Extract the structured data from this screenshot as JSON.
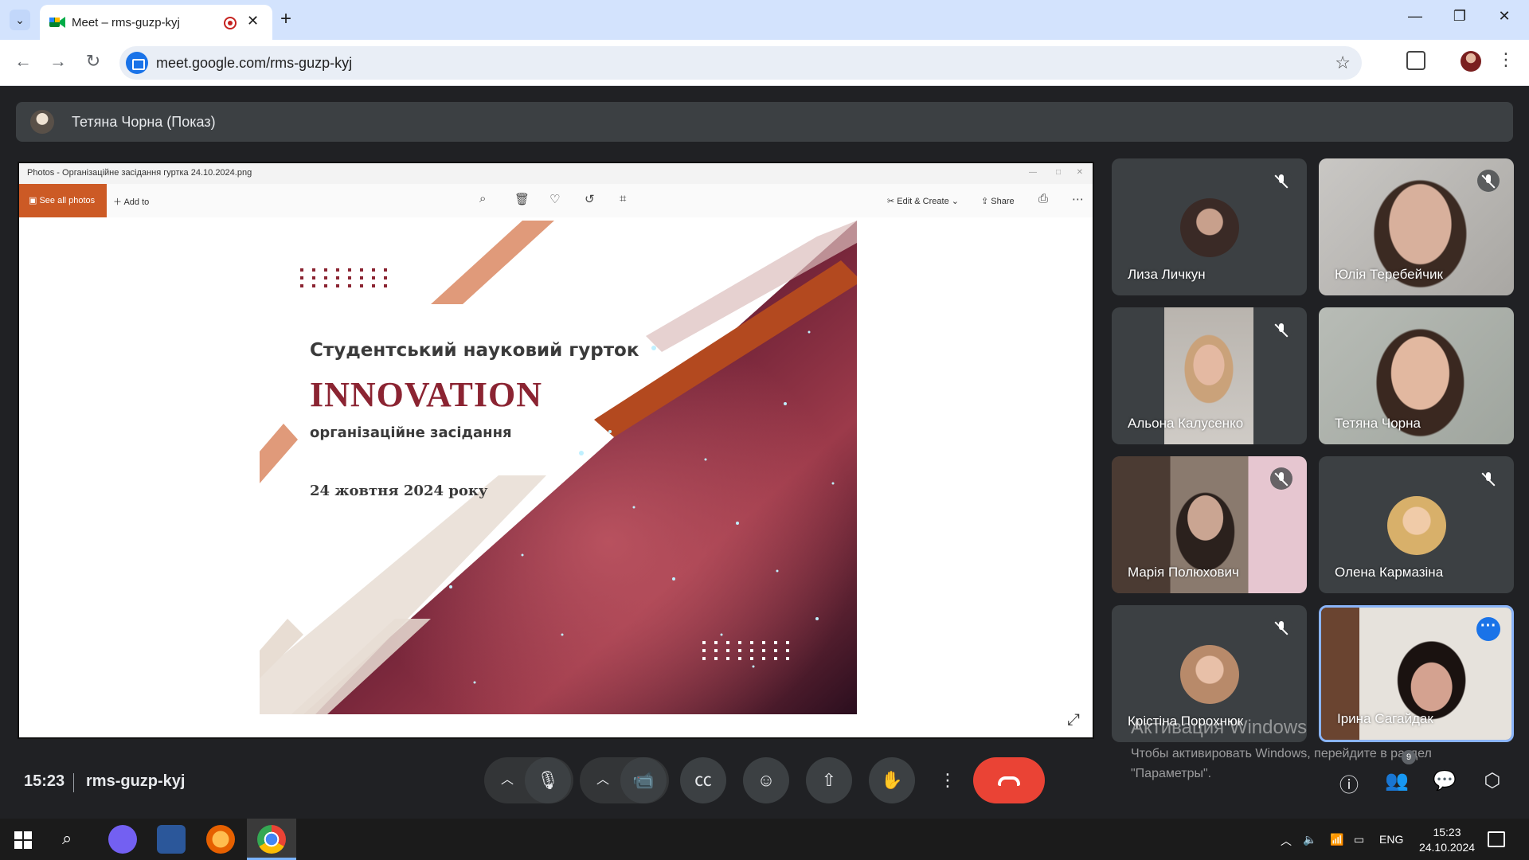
{
  "browser": {
    "tab_title": "Meet – rms-guzp-kyj",
    "url": "meet.google.com/rms-guzp-kyj"
  },
  "presenter": {
    "label": "Тетяна Чорна (Показ)"
  },
  "photos_app": {
    "title": "Photos - Організаційне засідання гуртка 24.10.2024.png",
    "see_all": "See all photos",
    "add_to": "Add to",
    "edit_create": "Edit & Create",
    "share": "Share"
  },
  "slide": {
    "line1": "Студентський науковий гурток",
    "line2": "INNOVATION",
    "line3": "організаційне засідання",
    "date": "24 жовтня 2024 року"
  },
  "participants": [
    {
      "name": "Лиза Личкун",
      "muted": true
    },
    {
      "name": "Юлія Теребейчик",
      "muted": true
    },
    {
      "name": "Альона Калусенко",
      "muted": true
    },
    {
      "name": "Тетяна Чорна",
      "muted": false
    },
    {
      "name": "Марія Полюхович",
      "muted": true
    },
    {
      "name": "Олена Кармазіна",
      "muted": true
    },
    {
      "name": "Крістіна Порохнюк",
      "muted": true
    },
    {
      "name": "Ірина Сагайдак",
      "muted": false
    }
  ],
  "watermark": {
    "title": "Активация Windows",
    "subtitle": "Чтобы активировать Windows, перейдите в раздел \"Параметры\"."
  },
  "meeting": {
    "time": "15:23",
    "code": "rms-guzp-kyj",
    "people_count": "9"
  },
  "taskbar": {
    "lang": "ENG",
    "time": "15:23",
    "date": "24.10.2024"
  },
  "colors": {
    "meet_bg": "#202124",
    "tile_bg": "#3c4043",
    "hangup": "#ea4335",
    "slide_accent": "#8b2432",
    "see_all_bg": "#cc5a25"
  }
}
